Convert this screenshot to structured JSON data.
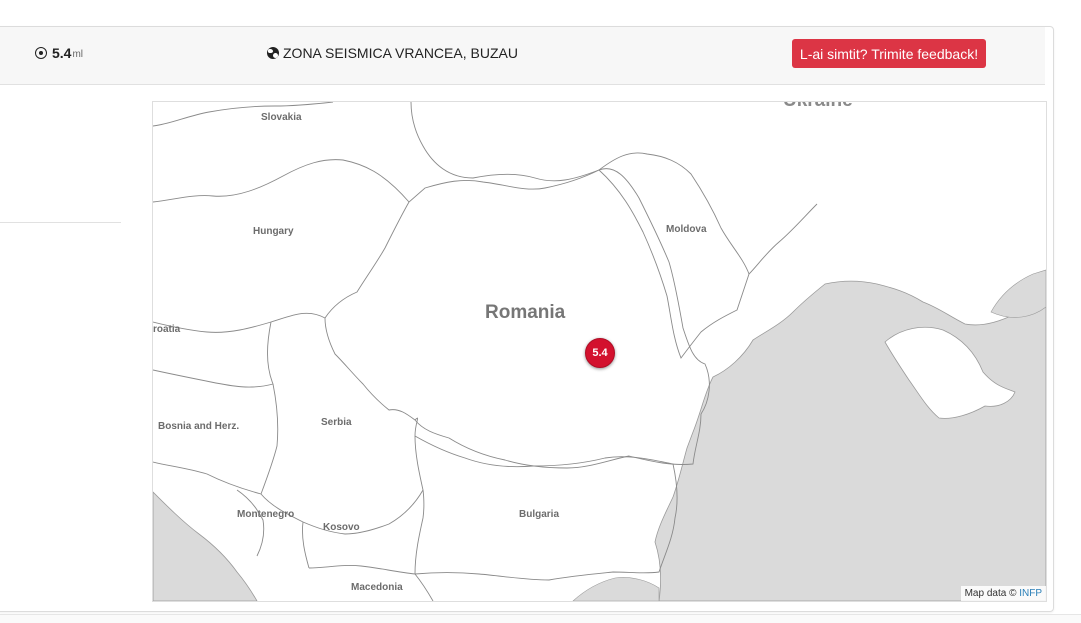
{
  "header": {
    "magnitude_value": "5.4",
    "magnitude_unit": "ml",
    "magnitude_icon": "target-icon",
    "zone_icon": "globe-icon",
    "zone": "ZONA SEISMICA VRANCEA, BUZAU",
    "feedback_button": "L-ai simtit? Trimite feedback!"
  },
  "colors": {
    "accent": "#dc3545",
    "marker": "#d3112e",
    "sea": "#dadada",
    "land": "#ffffff",
    "border": "#9a9a9a"
  },
  "map": {
    "countries": [
      "Ukraine",
      "Slovakia",
      "Hungary",
      "Moldova",
      "Romania",
      "roatia",
      "Bosnia and Herz.",
      "Serbia",
      "Montenegro",
      "Kosovo",
      "Bulgaria",
      "Macedonia"
    ],
    "marker_label": "5.4",
    "attribution_text": "Map data ©",
    "attribution_link": "INFP"
  }
}
